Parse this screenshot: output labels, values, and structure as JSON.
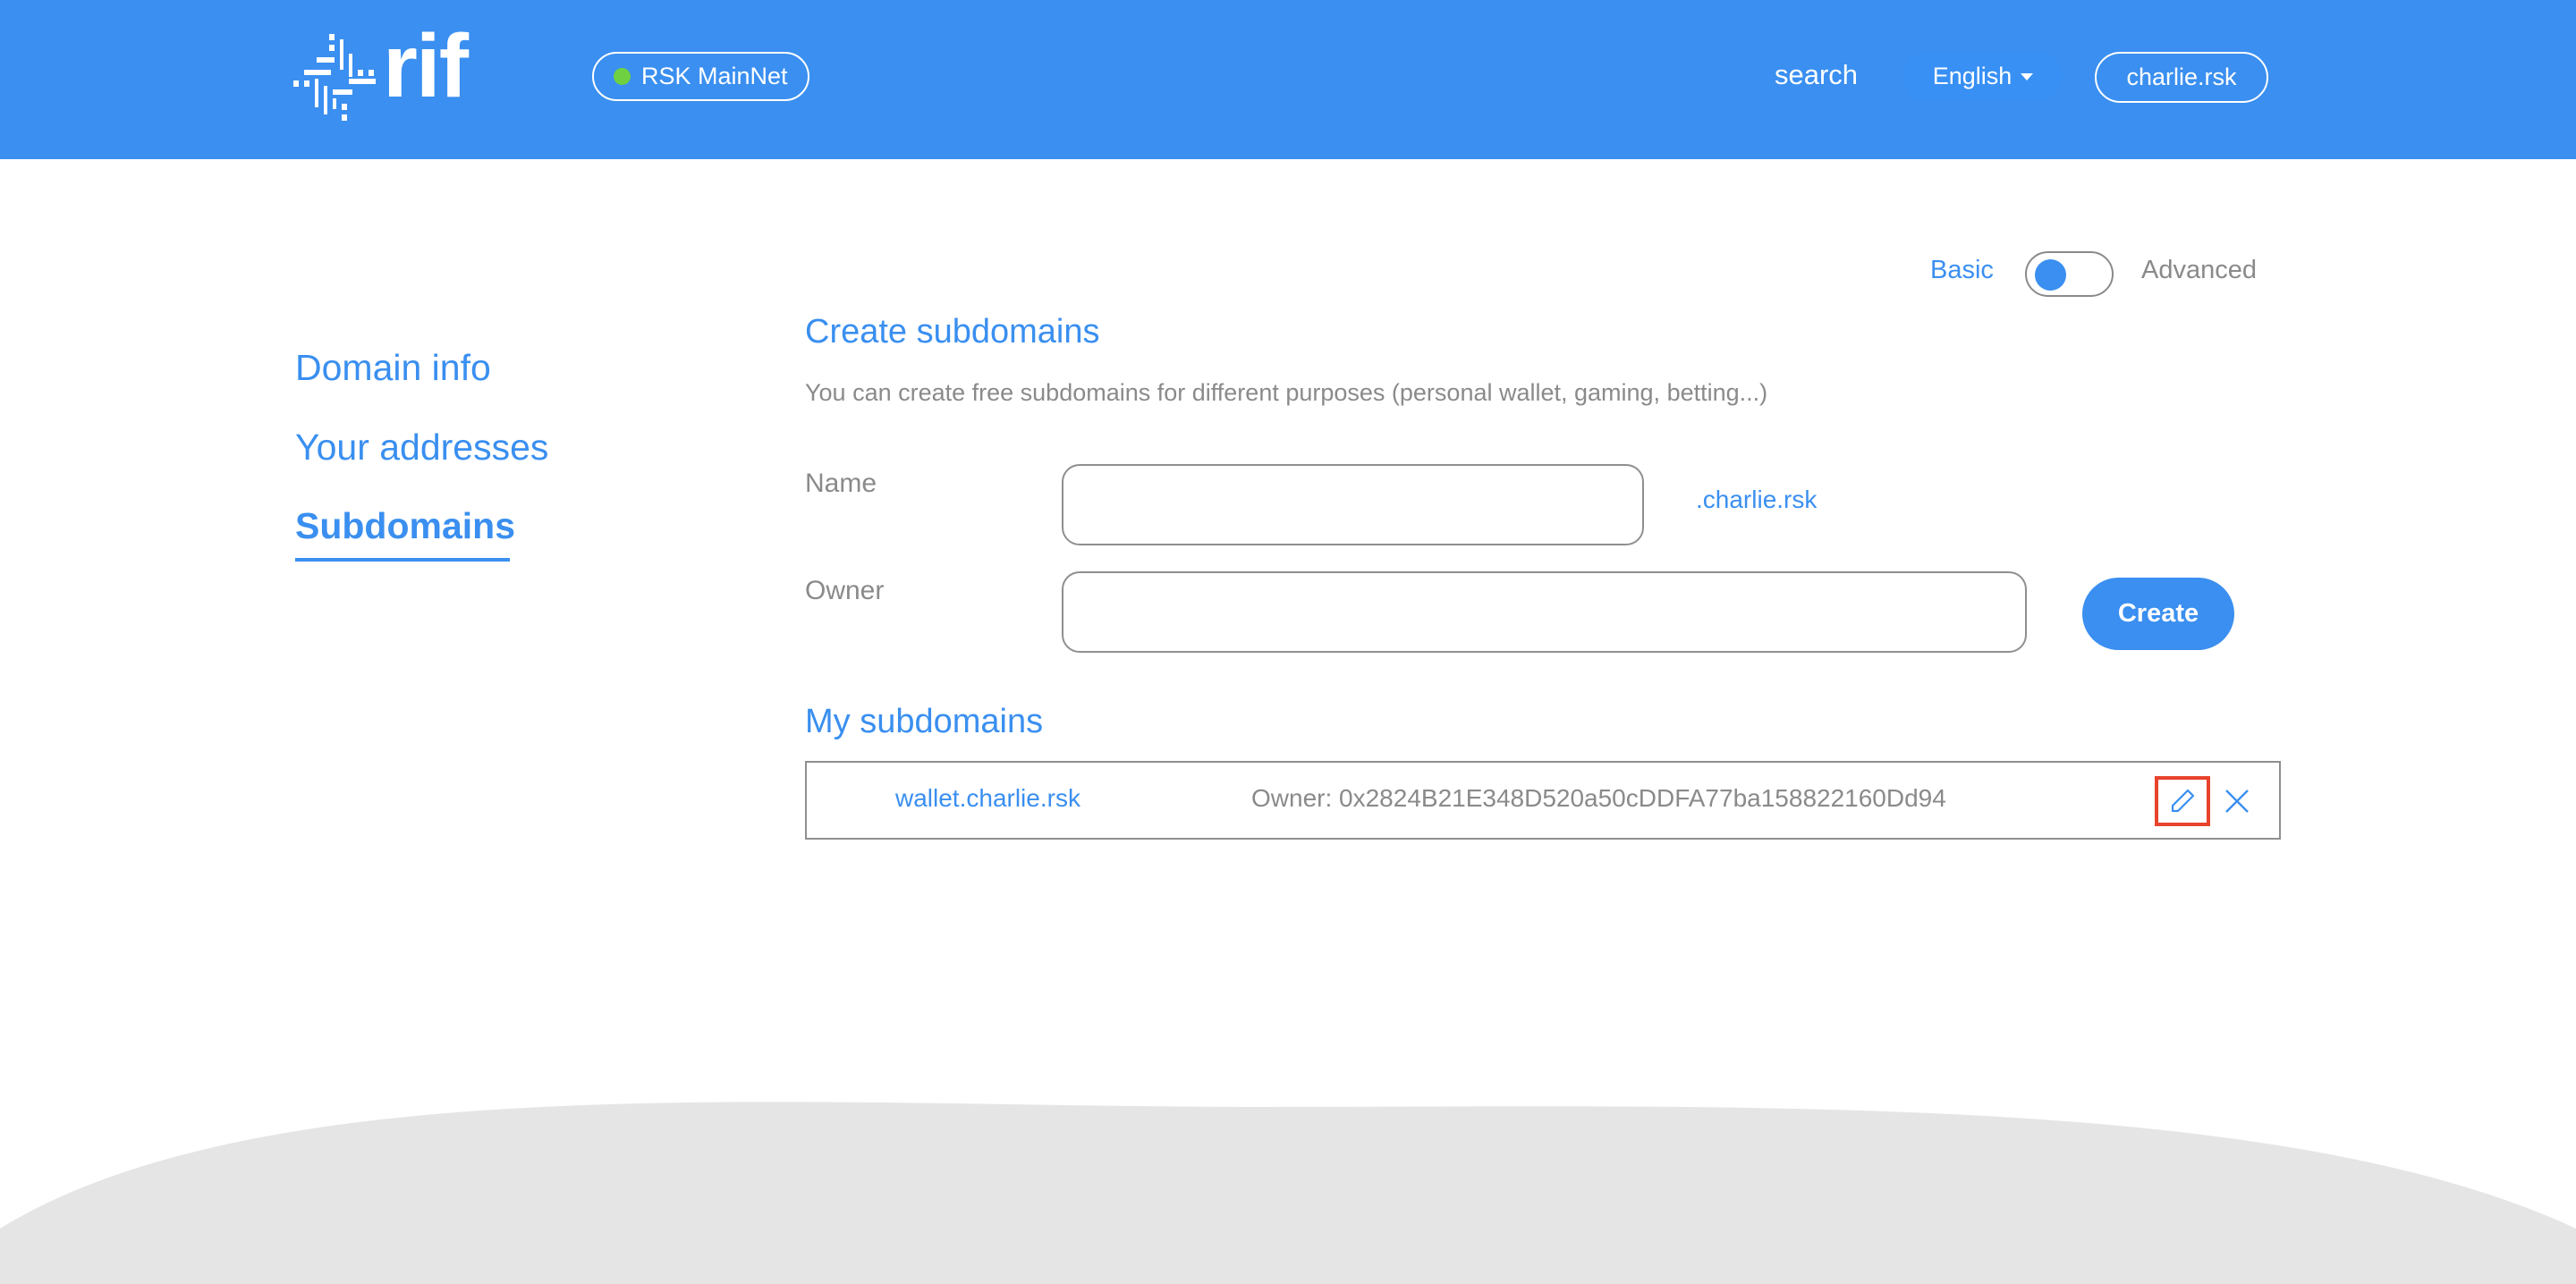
{
  "header": {
    "logo_text": "rif",
    "network": {
      "label": "RSK MainNet",
      "status_color": "#6fd142"
    },
    "search_label": "search",
    "language": {
      "selected": "English"
    },
    "user_domain": "charlie.rsk"
  },
  "view_toggle": {
    "left_label": "Basic",
    "right_label": "Advanced",
    "selected": "Basic"
  },
  "sidebar": {
    "items": [
      {
        "label": "Domain info",
        "active": false
      },
      {
        "label": "Your addresses",
        "active": false
      },
      {
        "label": "Subdomains",
        "active": true
      }
    ]
  },
  "create_section": {
    "title": "Create subdomains",
    "description": "You can create free subdomains for different purposes (personal wallet, gaming, betting...)",
    "name_label": "Name",
    "name_value": "",
    "name_suffix": ".charlie.rsk",
    "owner_label": "Owner",
    "owner_value": "",
    "create_label": "Create"
  },
  "my_subdomains": {
    "title": "My subdomains",
    "items": [
      {
        "name": "wallet.charlie.rsk",
        "owner": "Owner: 0x2824B21E348D520a50cDDFA77ba158822160Dd94"
      }
    ]
  },
  "colors": {
    "brand": "#3a8ff0",
    "muted_text": "#8a8a8a",
    "highlight_border": "#e8432c",
    "footer": "#e5e5e5"
  }
}
